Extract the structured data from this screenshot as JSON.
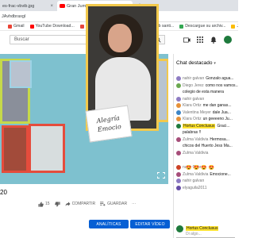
{
  "browser": {
    "tabs": [
      {
        "label": "es-frac-vbvib.jpg",
        "close": "×"
      },
      {
        "label": "Gran Jumbada · Proxima 2 Ji",
        "close": "×"
      }
    ],
    "new_tab": "+",
    "address": "JAvhdbraxgl",
    "bookmarks": [
      {
        "label": "Gmail",
        "color": "#ea4335"
      },
      {
        "label": "YouTube Download...",
        "color": "#ff0000"
      },
      {
        "label": "Convertir a PDF - 1...",
        "color": "#e8453c"
      },
      {
        "label": "boletines web santi...",
        "color": "#1a73e8"
      },
      {
        "label": "Descargue su archiv...",
        "color": "#34a853"
      },
      {
        "label": "Ji",
        "color": "#fbbc04"
      }
    ]
  },
  "youtube": {
    "search_placeholder": "Buscar",
    "video": {
      "sign_line1": "Alegría",
      "sign_line2": "Emocio",
      "title": "20",
      "likes": "15",
      "share": "COMPARTIR",
      "save": "GUARDAR",
      "more": "···"
    },
    "buttons": {
      "analytics": "ANALÍTICAS",
      "edit": "EDITAR VÍDEO"
    }
  },
  "chat": {
    "header": "Chat destacado",
    "messages": [
      {
        "name": "nahir galvan",
        "text": "Gonzalo agua...",
        "highlight": false,
        "avatar": "#8e7cc3"
      },
      {
        "name": "Diego Jerez",
        "text": "como nos vamos...",
        "highlight": false,
        "avatar": "#6aa84f"
      },
      {
        "name": "",
        "text": "colegio de esta manera",
        "highlight": false,
        "avatar": ""
      },
      {
        "name": "nahir galvan",
        "text": "",
        "highlight": false,
        "avatar": "#8e7cc3"
      },
      {
        "name": "Klara Ortiz",
        "text": "me dan ganas...",
        "highlight": false,
        "avatar": "#e69138"
      },
      {
        "name": "Valentina Meyer",
        "text": "dale Jua...",
        "highlight": false,
        "avatar": "#3d85c6"
      },
      {
        "name": "Klara Ortiz",
        "text": "un geeeeno Ju...",
        "highlight": false,
        "avatar": "#e69138"
      },
      {
        "name": "Hortus Conclusus",
        "text": "Graci...",
        "highlight": true,
        "avatar": "#1e7a3c"
      },
      {
        "name": "",
        "text": "palabras !!",
        "highlight": false,
        "avatar": ""
      },
      {
        "name": "Zulma Valdivia",
        "text": "Hermosa...",
        "highlight": false,
        "avatar": "#a64d79"
      },
      {
        "name": "",
        "text": "chicos del Huerto Jess Ma...",
        "highlight": false,
        "avatar": ""
      },
      {
        "name": "Zulma Valdivia",
        "text": "",
        "highlight": false,
        "avatar": "#a64d79"
      },
      {
        "name": "nahir Cabral",
        "text": "",
        "highlight": false,
        "avatar": "#cc4125"
      },
      {
        "name": "Zulma Valdivia",
        "text": "Emocione...",
        "highlight": false,
        "avatar": "#a64d79"
      },
      {
        "name": "nahir galvan",
        "text": "",
        "highlight": false,
        "avatar": "#8e7cc3"
      },
      {
        "name": "elyaguila2011",
        "text": "",
        "highlight": false,
        "avatar": "#674ea7"
      }
    ],
    "emoji": [
      "😍",
      "😍",
      "😍",
      "😍"
    ],
    "input_user": "Hortus Conclusus",
    "input_placeholder": "Di algo..."
  }
}
